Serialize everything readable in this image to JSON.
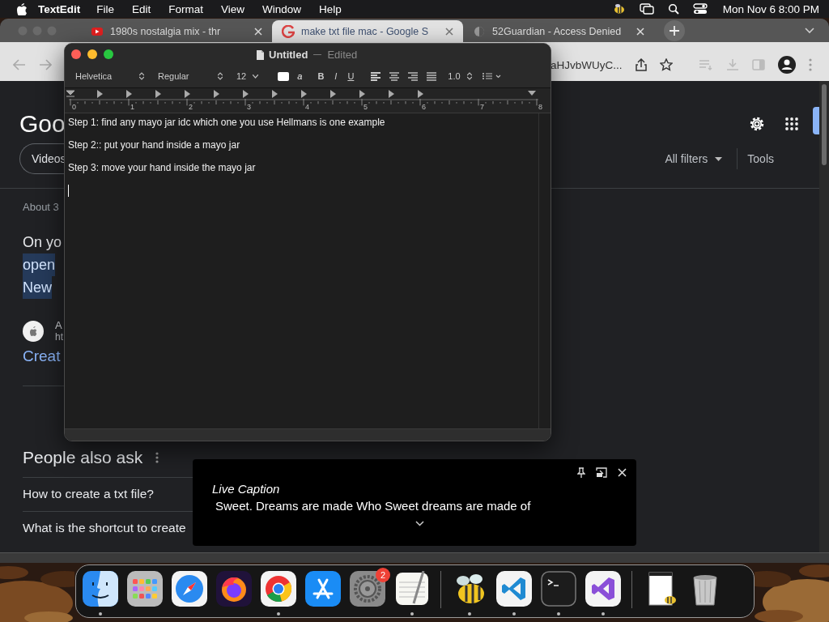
{
  "menu_bar": {
    "app": "TextEdit",
    "menus": [
      "File",
      "Edit",
      "Format",
      "View",
      "Window",
      "Help"
    ],
    "clock": "Mon Nov 6  8:00 PM"
  },
  "browser": {
    "tabs": [
      {
        "title": "1980s nostalgia mix - thr",
        "selected": false
      },
      {
        "title": "make txt file mac - Google S",
        "selected": true
      },
      {
        "title": "52Guardian - Access Denied",
        "selected": false
      }
    ],
    "address": "aHJvbWUyC...",
    "page": {
      "logo": "Goo",
      "chip": "Videos",
      "filters": "All filters",
      "tools": "Tools",
      "result_count": "About 3",
      "snippet": [
        {
          "text": "On yo",
          "highlighted": false
        },
        {
          "text": "open",
          "highlighted": true
        },
        {
          "text": "New",
          "highlighted": true
        }
      ],
      "source": {
        "name": "A",
        "url": "ht"
      },
      "link": "Creat",
      "people_also_ask": {
        "title": "People also ask",
        "questions": [
          "How to create a txt file?",
          "What is the shortcut to create"
        ]
      }
    }
  },
  "textedit": {
    "title": "Untitled",
    "status": "Edited",
    "font": "Helvetica",
    "style": "Regular",
    "size": "12",
    "highlight": "a",
    "bold": "B",
    "italic": "I",
    "underline": "U",
    "line_spacing": "1.0",
    "ruler": [
      "0",
      "1",
      "2",
      "3",
      "4",
      "5",
      "6",
      "7",
      "8"
    ],
    "lines": [
      "Step 1: find any mayo jar idc which one you use Hellmans is one example",
      "Step 2:: put your hand inside a mayo jar",
      "Step 3:  move your hand inside the mayo jar"
    ]
  },
  "live_caption": {
    "title": "Live Caption",
    "text": "Sweet. Dreams are made Who Sweet dreams are made of"
  },
  "dock": {
    "items": [
      {
        "kind": "finder",
        "running": true
      },
      {
        "kind": "launchpad",
        "running": false
      },
      {
        "kind": "safari",
        "running": false
      },
      {
        "kind": "firefox",
        "running": false
      },
      {
        "kind": "chrome",
        "running": true
      },
      {
        "kind": "appstore",
        "running": false
      },
      {
        "kind": "settings",
        "running": false,
        "badge": "2"
      },
      {
        "kind": "notes",
        "running": true
      },
      {
        "kind": "separator"
      },
      {
        "kind": "bee",
        "running": true
      },
      {
        "kind": "vscode",
        "running": true
      },
      {
        "kind": "terminal",
        "running": true
      },
      {
        "kind": "visualstudio",
        "running": true
      },
      {
        "kind": "separator"
      },
      {
        "kind": "document",
        "running": false
      },
      {
        "kind": "trash",
        "running": false
      }
    ]
  }
}
